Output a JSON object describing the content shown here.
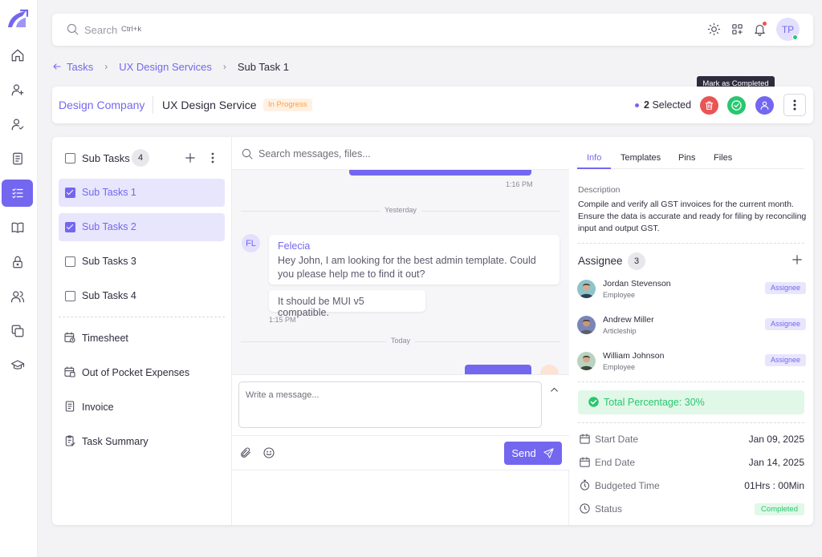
{
  "topbar": {
    "search_placeholder": "Search",
    "search_shortcut": "Ctrl+k",
    "user_initials": "TP"
  },
  "breadcrumb": {
    "items": [
      "Tasks",
      "UX Design Services",
      "Sub Task 1"
    ]
  },
  "header": {
    "company": "Design Company",
    "service": "UX Design Service",
    "status": "In Progress",
    "selected_count": "2",
    "selected_label": "Selected",
    "tooltip": "Mark as Completed"
  },
  "subtasks": {
    "title": "Sub Tasks",
    "count": "4",
    "items": [
      {
        "label": "Sub Tasks 1",
        "checked": true
      },
      {
        "label": "Sub Tasks 2",
        "checked": true
      },
      {
        "label": "Sub Tasks 3",
        "checked": false
      },
      {
        "label": "Sub Tasks 4",
        "checked": false
      }
    ],
    "links": [
      {
        "label": "Timesheet",
        "icon": "calendar-clock-icon"
      },
      {
        "label": "Out of Pocket Expenses",
        "icon": "calendar-receipt-icon"
      },
      {
        "label": "Invoice",
        "icon": "invoice-icon"
      },
      {
        "label": "Task Summary",
        "icon": "clipboard-check-icon"
      }
    ]
  },
  "chat": {
    "search_placeholder": "Search messages, files...",
    "time_1": "1:16 PM",
    "day_1": "Yesterday",
    "sender_initials": "FL",
    "sender_name": "Felecia",
    "message_1": "Hey John, I am looking for the best admin template. Could you please help me to find it out?",
    "message_2": "It should be MUI v5 compatible.",
    "time_2": "1:15 PM",
    "day_2": "Today",
    "input_placeholder": "Write a message...",
    "send_label": "Send"
  },
  "info": {
    "tabs": [
      "Info",
      "Templates",
      "Pins",
      "Files"
    ],
    "active_tab": "Info",
    "description_label": "Description",
    "description": "Compile and verify all GST invoices for the current month. Ensure the data is accurate and ready for filing by reconciling input and output GST.",
    "assignee_title": "Assignee",
    "assignee_count": "3",
    "assignees": [
      {
        "name": "Jordan Stevenson",
        "role": "Employee",
        "tag": "Assignee"
      },
      {
        "name": "Andrew Miller",
        "role": "Articleship",
        "tag": "Assignee"
      },
      {
        "name": "William Johnson",
        "role": "Employee",
        "tag": "Assignee"
      }
    ],
    "total_percentage": "Total Percentage: 30%",
    "start_date_label": "Start Date",
    "start_date": "Jan 09, 2025",
    "end_date_label": "End Date",
    "end_date": "Jan 14, 2025",
    "budgeted_label": "Budgeted Time",
    "budgeted": "01Hrs : 00Min",
    "status_label": "Status",
    "status": "Completed"
  },
  "colors": {
    "primary": "#7367f0",
    "success": "#28c76f",
    "danger": "#ea5455",
    "warning": "#ff9f43"
  }
}
